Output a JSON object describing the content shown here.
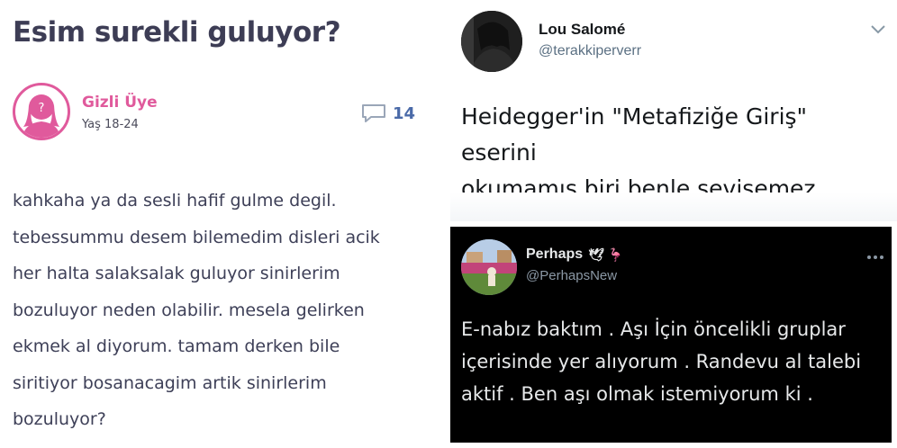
{
  "question": {
    "title": "Esim surekli guluyor?",
    "author": "Gizli Üye",
    "age_label": "Yaş 18-24",
    "comment_count": "14",
    "body_lines": [
      "kahkaha ya da sesli hafif gulme degil.",
      "tebessummu desem bilemedim disleri acik",
      "her halta salaksalak guluyor sinirlerim",
      "bozuluyor neden olabilir. mesela gelirken",
      "ekmek al diyorum. tamam derken bile",
      "siritiyor bosanacagim artik sinirlerim",
      "bozuluyor?"
    ],
    "colors": {
      "title": "#3d3d55",
      "accent": "#e05a9c",
      "count": "#4a6aa8"
    }
  },
  "tweet_top": {
    "name": "Lou Salomé",
    "handle": "@terakkiperverr",
    "text_lines": [
      "Heidegger'in \"Metafiziğe Giriş\" eserini",
      "okumamış biri benle sevişemez."
    ],
    "menu_icon": "chevron-down-icon"
  },
  "tweet_bottom": {
    "name": "Perhaps",
    "name_emojis": "🕊 🦩",
    "handle": "@PerhapsNew",
    "text_lines": [
      "E-nabız baktım . Aşı İçin öncelikli gruplar",
      "içerisinde yer alıyorum .  Randevu al talebi",
      "aktif . Ben aşı olmak istemiyorum ki ."
    ],
    "menu_icon": "more-dots-icon",
    "theme": {
      "bg": "#000000",
      "text": "#e7e9ea",
      "secondary": "#8b98a5"
    }
  }
}
